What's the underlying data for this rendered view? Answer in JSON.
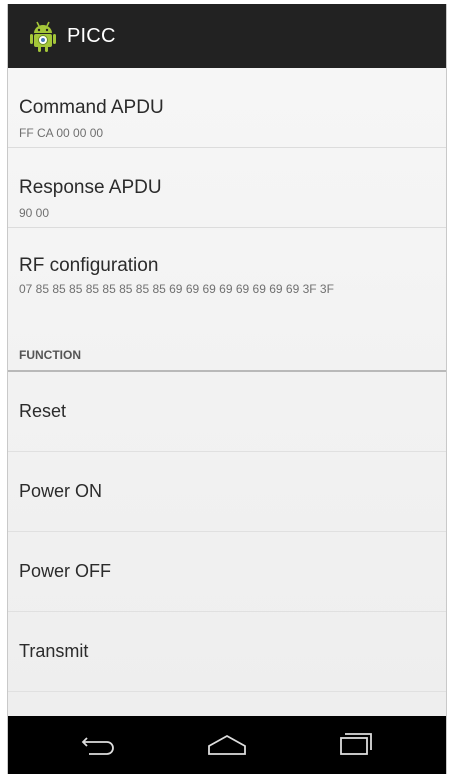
{
  "app": {
    "title": "PICC",
    "icon": "android-robot-icon"
  },
  "preferences": [
    {
      "title": "Command APDU",
      "summary": "FF CA 00 00 00"
    },
    {
      "title": "Response APDU",
      "summary": "90 00"
    },
    {
      "title": "RF configuration",
      "summary": "07 85 85 85 85 85 85 85 85 69 69 69 69 69 69 69 69 3F 3F"
    }
  ],
  "category": {
    "label": "FUNCTION"
  },
  "actions": [
    {
      "label": "Reset"
    },
    {
      "label": "Power ON"
    },
    {
      "label": "Power OFF"
    },
    {
      "label": "Transmit"
    }
  ],
  "nav": {
    "back_icon": "back-icon",
    "home_icon": "home-icon",
    "recents_icon": "recent-apps-icon"
  },
  "colors": {
    "action_bar": "#222222",
    "nav_bar": "#000000",
    "android_green": "#a4c639"
  }
}
